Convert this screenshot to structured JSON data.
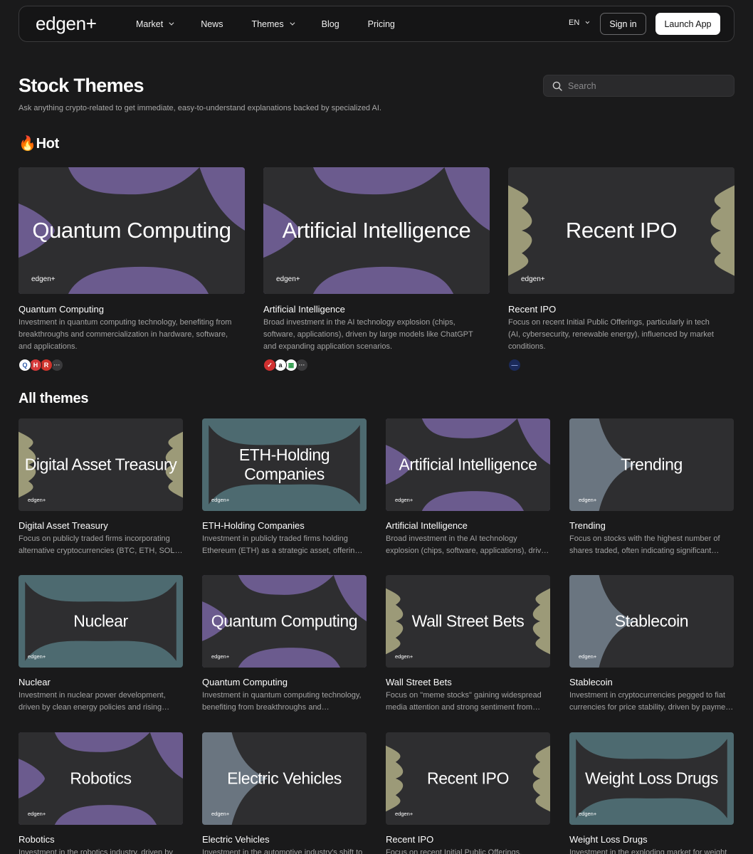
{
  "nav": {
    "logo": "edgen+",
    "links": [
      "Market",
      "News",
      "Themes",
      "Blog",
      "Pricing"
    ],
    "language": "EN",
    "signin_label": "Sign in",
    "launch_label": "Launch App"
  },
  "header": {
    "title": "Stock Themes",
    "subtitle": "Ask anything crypto-related to get immediate, easy-to-understand explanations backed by specialized AI.",
    "search_placeholder": "Search"
  },
  "hot": {
    "title": "🔥Hot",
    "cards": [
      {
        "thumb_title": "Quantum Computing",
        "thumb_logo": "edgen+",
        "name": "Quantum Computing",
        "desc": "Investment in quantum computing technology, benefiting from breakthroughs and commercialization in hardware, software, and applications.",
        "icons": [
          {
            "label": "Q",
            "color": "#ffffff",
            "fg": "#2e5aa8"
          },
          {
            "label": "H",
            "color": "#d63a3a",
            "fg": "#ffffff"
          },
          {
            "label": "R",
            "color": "#d0342c",
            "fg": "#ffffff"
          },
          {
            "label": "···",
            "color": "#3a3a3c",
            "fg": "#bbbbbb"
          }
        ]
      },
      {
        "thumb_title": "Artificial Intelligence",
        "thumb_logo": "edgen+",
        "name": "Artificial Intelligence",
        "desc": "Broad investment in the AI technology explosion (chips, software, applications), driven by large models like ChatGPT and expanding application scenarios.",
        "icons": [
          {
            "label": "✓",
            "color": "#d03030",
            "fg": "#ffffff"
          },
          {
            "label": "a",
            "color": "#ffffff",
            "fg": "#111111"
          },
          {
            "label": "▦",
            "color": "#ffffff",
            "fg": "#2d9b4a"
          },
          {
            "label": "···",
            "color": "#3a3a3c",
            "fg": "#bbbbbb"
          }
        ]
      },
      {
        "thumb_title": "Recent IPO",
        "thumb_logo": "edgen+",
        "name": "Recent IPO",
        "desc": "Focus on recent Initial Public Offerings, particularly in tech (AI, cybersecurity, renewable energy), influenced by market conditions.",
        "icons": [
          {
            "label": "—",
            "color": "#1b2a5a",
            "fg": "#8aa0e0"
          }
        ]
      }
    ]
  },
  "all": {
    "title": "All themes",
    "cards": [
      {
        "thumb_title": "Digital Asset Treasury",
        "thumb_logo": "edgen+",
        "name": "Digital Asset Treasury",
        "desc": "Focus on publicly traded firms incorporating alternative cryptocurrencies (BTC, ETH, SOL) as treasury assets."
      },
      {
        "thumb_title": "ETH-Holding Companies",
        "thumb_logo": "edgen+",
        "name": "ETH-Holding Companies",
        "desc": "Investment in publicly traded firms holding Ethereum (ETH) as a strategic asset, offering exposure to crypto."
      },
      {
        "thumb_title": "Artificial Intelligence",
        "thumb_logo": "edgen+",
        "name": "Artificial Intelligence",
        "desc": "Broad investment in the AI technology explosion (chips, software, applications), driven by large models."
      },
      {
        "thumb_title": "Trending",
        "thumb_logo": "edgen+",
        "name": "Trending",
        "desc": "Focus on stocks with the highest number of shares traded, often indicating significant market interest."
      },
      {
        "thumb_title": "Nuclear",
        "thumb_logo": "edgen+",
        "name": "Nuclear",
        "desc": "Investment in nuclear power development, driven by clean energy policies and rising electricity demand."
      },
      {
        "thumb_title": "Quantum Computing",
        "thumb_logo": "edgen+",
        "name": "Quantum Computing",
        "desc": "Investment in quantum computing technology, benefiting from breakthroughs and commercialization."
      },
      {
        "thumb_title": "Wall Street Bets",
        "thumb_logo": "edgen+",
        "name": "Wall Street Bets",
        "desc": "Focus on \"meme stocks\" gaining widespread media attention and strong sentiment from retail investors."
      },
      {
        "thumb_title": "Stablecoin",
        "thumb_logo": "edgen+",
        "name": "Stablecoin",
        "desc": "Investment in cryptocurrencies pegged to fiat currencies for price stability, driven by payment adoption."
      },
      {
        "thumb_title": "Robotics",
        "thumb_logo": "edgen+",
        "name": "Robotics",
        "desc": "Investment in the robotics industry, driven by automation and AI advances."
      },
      {
        "thumb_title": "Electric Vehicles",
        "thumb_logo": "edgen+",
        "name": "Electric Vehicles",
        "desc": "Investment in the automotive industry's shift to electric vehicles."
      },
      {
        "thumb_title": "Recent IPO",
        "thumb_logo": "edgen+",
        "name": "Recent IPO",
        "desc": "Focus on recent Initial Public Offerings."
      },
      {
        "thumb_title": "Weight Loss Drugs",
        "thumb_logo": "edgen+",
        "name": "Weight Loss Drugs",
        "desc": "Investment in the exploding market for weight loss drugs."
      }
    ]
  },
  "colors": {
    "purple": "#6b5b8e",
    "olive": "#9c9a78",
    "teal": "#4d6a70",
    "slate": "#6a7580",
    "dark": "#2e2e30"
  }
}
